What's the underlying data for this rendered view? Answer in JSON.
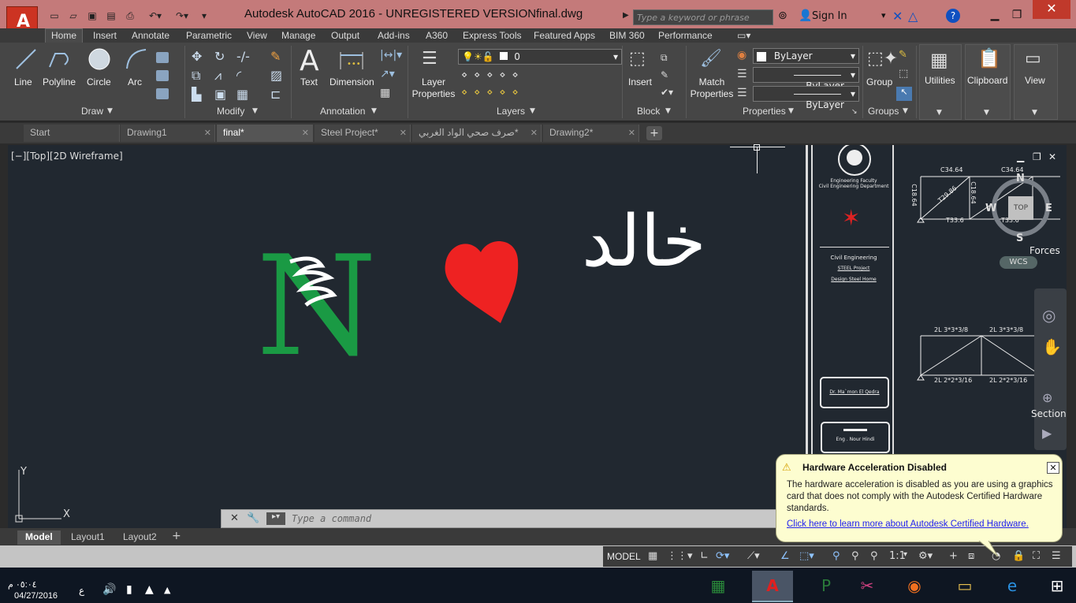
{
  "titlebar": {
    "app_title": "Autodesk AutoCAD 2016 - UNREGISTERED VERSION",
    "file_name": "final.dwg",
    "search_placeholder": "Type a keyword or phrase",
    "signin": "Sign In"
  },
  "ribbon_tabs": [
    "Home",
    "Insert",
    "Annotate",
    "Parametric",
    "View",
    "Manage",
    "Output",
    "Add-ins",
    "A360",
    "Express Tools",
    "Featured Apps",
    "BIM 360",
    "Performance"
  ],
  "draw": {
    "line": "Line",
    "polyline": "Polyline",
    "circle": "Circle",
    "arc": "Arc",
    "panel": "Draw"
  },
  "modify": {
    "panel": "Modify"
  },
  "annotation": {
    "text": "Text",
    "dimension": "Dimension",
    "panel": "Annotation"
  },
  "layers": {
    "layer_properties": "Layer Properties",
    "current_layer": "0",
    "panel": "Layers"
  },
  "block": {
    "insert": "Insert",
    "panel": "Block"
  },
  "properties": {
    "match": "Match Properties",
    "color": "ByLayer",
    "linetype": "ByLayer",
    "lineweight": "ByLayer",
    "panel": "Properties"
  },
  "groups": {
    "group": "Group",
    "panel": "Groups"
  },
  "utilities": {
    "label": "Utilities"
  },
  "clipboard": {
    "label": "Clipboard"
  },
  "view": {
    "label": "View"
  },
  "file_tabs": [
    "Start",
    "Drawing1",
    "final*",
    "Steel Project*",
    "صرف صحي الواد الغربي*",
    "Drawing2*"
  ],
  "canvas": {
    "view_label": "[−][Top][2D Wireframe]",
    "arabic_name": "خالد",
    "letter": "N",
    "heart_color": "#ee2222",
    "n_color": "#1a9a44"
  },
  "title_block": {
    "faculty": "Engineering Faculty",
    "department": "Civil Engineering Department",
    "civil": "Civil Engineering",
    "project": "STEEL Project",
    "design": "Design Steel Home",
    "supervisor": "Dr. Ma`mon El Qedra",
    "student": "Eng . Nour Hindi"
  },
  "truss_labels": {
    "top1": "C34.64",
    "top2": "C34.64",
    "diag1": "T29.86",
    "bot1": "T33.6",
    "bot2": "T33.6",
    "vert1": "C18.64",
    "vert2": "C18.64",
    "chord1": "2L 3*3*3/8",
    "chord2": "2L 3*3*3/8",
    "bchord1": "2L 2*2*3/16",
    "bchord2": "2L 2*2*3/16"
  },
  "navcube": {
    "top": "TOP",
    "n": "N",
    "s": "S",
    "e": "E",
    "w": "W",
    "wcs": "WCS"
  },
  "side_labels": {
    "forces": "Forces",
    "section": "Section"
  },
  "command": {
    "placeholder": "Type a command"
  },
  "layout_tabs": [
    "Model",
    "Layout1",
    "Layout2"
  ],
  "status": {
    "model": "MODEL",
    "scale": "1:1"
  },
  "popup": {
    "title": "Hardware Acceleration Disabled",
    "body": "The hardware acceleration is disabled as you are using a graphics card that does not comply with the Autodesk Certified Hardware standards.",
    "link": "Click here to learn more about Autodesk Certified Hardware."
  },
  "taskbar": {
    "time": "٠٥:٠٤ م",
    "date": "04/27/2016",
    "lang": "ع"
  }
}
